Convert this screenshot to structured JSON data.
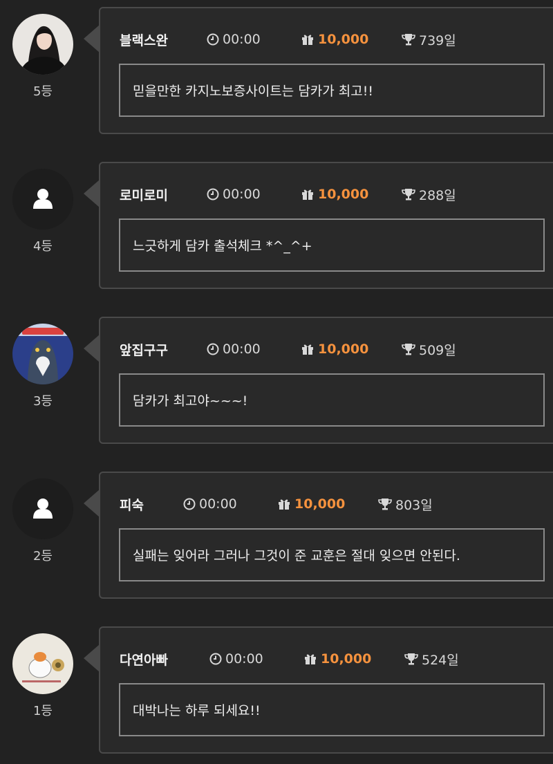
{
  "entries": [
    {
      "name": "블랙스완",
      "time": "00:00",
      "points": "10,000",
      "days": "739일",
      "comment": "믿을만한 카지노보증사이트는 담카가 최고!!",
      "rank": "5등",
      "avatar": "photo-woman"
    },
    {
      "name": "로미로미",
      "time": "00:00",
      "points": "10,000",
      "days": "288일",
      "comment": "느긋하게 담카 출석체크 *^_^+",
      "rank": "4등",
      "avatar": "default-user"
    },
    {
      "name": "앞집구구",
      "time": "00:00",
      "points": "10,000",
      "days": "509일",
      "comment": "담카가 최고야~~~!",
      "rank": "3등",
      "avatar": "penguin-cartoon"
    },
    {
      "name": "피숙",
      "time": "00:00",
      "points": "10,000",
      "days": "803일",
      "comment": "실패는 잊어라 그러나 그것이 준 교훈은 절대 잊으면 안된다.",
      "rank": "2등",
      "avatar": "default-user"
    },
    {
      "name": "다연아빠",
      "time": "00:00",
      "points": "10,000",
      "days": "524일",
      "comment": "대박나는 하루 되세요!!",
      "rank": "1등",
      "avatar": "hamster-cartoon"
    }
  ],
  "colors": {
    "background": "#222222",
    "card": "#292929",
    "border": "#4a4a4a",
    "points": "#f5923e"
  }
}
